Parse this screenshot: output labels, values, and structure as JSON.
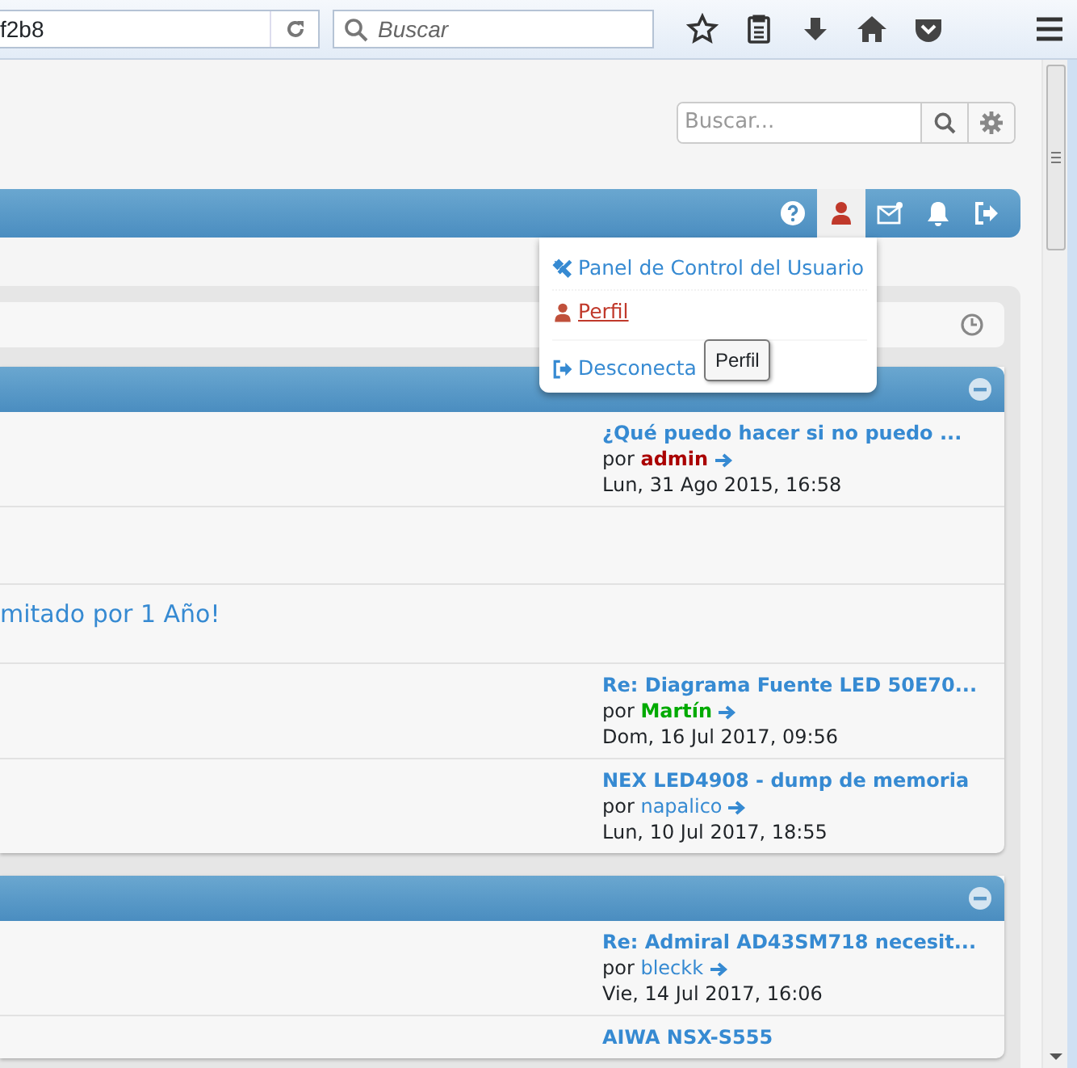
{
  "browser": {
    "address": "f2b8",
    "search": {
      "placeholder": "Buscar"
    },
    "toolbar": [
      {
        "kind": "star"
      },
      {
        "kind": "reader"
      },
      {
        "kind": "download"
      },
      {
        "kind": "home"
      },
      {
        "kind": "pocket"
      },
      {
        "kind": "menu"
      }
    ]
  },
  "site_search": {
    "placeholder": "Buscar..."
  },
  "navbar": {
    "icons": [
      {
        "kind": "help",
        "selected": false
      },
      {
        "kind": "user",
        "selected": true
      },
      {
        "kind": "messages",
        "selected": false
      },
      {
        "kind": "notifications",
        "selected": false
      },
      {
        "kind": "logout",
        "selected": false
      }
    ]
  },
  "user_menu": {
    "items": [
      {
        "kind": "tools",
        "label": "Panel de Control del Usuario",
        "hovered": false
      },
      {
        "kind": "user",
        "label": "Perfil",
        "hovered": true
      },
      {
        "kind": "logout",
        "label": "Desconecta",
        "hovered": false
      }
    ],
    "tooltip": "Perfil"
  },
  "sections": [
    {
      "rows": [
        {
          "kind": "last_post",
          "title": "¿Qué puedo hacer si no puedo ...",
          "by": "por",
          "author": "admin",
          "color": "#aa0000",
          "date": "Lun, 31 Ago 2015, 16:58"
        },
        {
          "kind": "empty"
        },
        {
          "kind": "text",
          "text": "mitado por 1 Año!"
        },
        {
          "kind": "last_post",
          "title": "Re: Diagrama Fuente LED 50E70...",
          "by": "por",
          "author": "Martín",
          "color": "#00aa00",
          "date": "Dom, 16 Jul 2017, 09:56"
        },
        {
          "kind": "last_post",
          "title": "NEX LED4908 - dump de memoria",
          "by": "por",
          "author": "napalico",
          "color": "#368ad2",
          "date": "Lun, 10 Jul 2017, 18:55"
        }
      ]
    },
    {
      "rows": [
        {
          "kind": "last_post",
          "title": "Re: Admiral AD43SM718 necesit...",
          "by": "por",
          "author": "bleckk",
          "color": "#368ad2",
          "date": "Vie, 14 Jul 2017, 16:06"
        },
        {
          "kind": "last_post",
          "title": "AIWA NSX-S555"
        }
      ]
    }
  ]
}
